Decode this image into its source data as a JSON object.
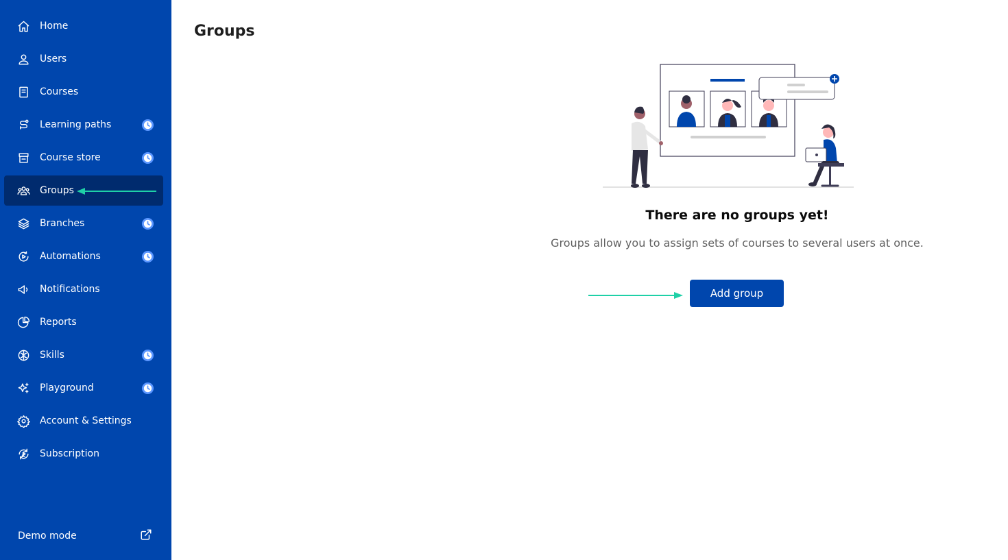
{
  "sidebar": {
    "items": [
      {
        "label": "Home",
        "icon": "home-icon",
        "badge": false,
        "active": false
      },
      {
        "label": "Users",
        "icon": "user-icon",
        "badge": false,
        "active": false
      },
      {
        "label": "Courses",
        "icon": "book-icon",
        "badge": false,
        "active": false
      },
      {
        "label": "Learning paths",
        "icon": "path-icon",
        "badge": true,
        "active": false
      },
      {
        "label": "Course store",
        "icon": "store-icon",
        "badge": true,
        "active": false
      },
      {
        "label": "Groups",
        "icon": "groups-icon",
        "badge": false,
        "active": true
      },
      {
        "label": "Branches",
        "icon": "layers-icon",
        "badge": true,
        "active": false
      },
      {
        "label": "Automations",
        "icon": "automation-icon",
        "badge": true,
        "active": false
      },
      {
        "label": "Notifications",
        "icon": "megaphone-icon",
        "badge": false,
        "active": false
      },
      {
        "label": "Reports",
        "icon": "pie-chart-icon",
        "badge": false,
        "active": false
      },
      {
        "label": "Skills",
        "icon": "brain-icon",
        "badge": true,
        "active": false
      },
      {
        "label": "Playground",
        "icon": "sparkle-icon",
        "badge": true,
        "active": false
      },
      {
        "label": "Account & Settings",
        "icon": "gear-icon",
        "badge": false,
        "active": false
      },
      {
        "label": "Subscription",
        "icon": "subscription-icon",
        "badge": false,
        "active": false
      }
    ],
    "demo_mode_label": "Demo mode"
  },
  "main": {
    "title": "Groups",
    "empty_title": "There are no groups yet!",
    "empty_description": "Groups allow you to assign sets of courses to several users at once.",
    "add_button_label": "Add group"
  },
  "colors": {
    "sidebar_bg": "#0046ad",
    "sidebar_active_bg": "#002b6e",
    "primary": "#0046ad",
    "arrow": "#1fd0a7",
    "badge_bg": "#5a96ff"
  }
}
